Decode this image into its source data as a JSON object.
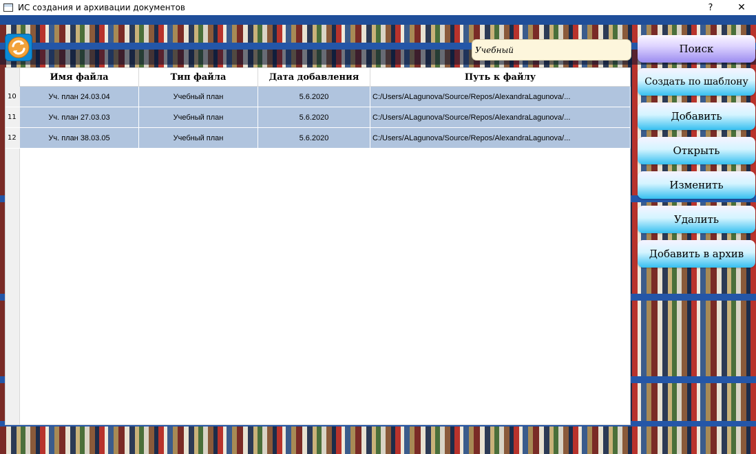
{
  "window": {
    "title": "ИС создания и архивации документов",
    "help_label": "?",
    "close_label": "✕"
  },
  "search": {
    "value": "Учебный"
  },
  "table": {
    "columns": [
      "Имя файла",
      "Тип файла",
      "Дата добавления",
      "Путь к файлу"
    ],
    "rows": [
      {
        "num": "10",
        "name": "Уч. план 24.03.04",
        "type": "Учебный план",
        "date": "5.6.2020",
        "path": "C:/Users/ALagunova/Source/Repos/AlexandraLagunova/..."
      },
      {
        "num": "11",
        "name": "Уч. план 27.03.03",
        "type": "Учебный план",
        "date": "5.6.2020",
        "path": "C:/Users/ALagunova/Source/Repos/AlexandraLagunova/..."
      },
      {
        "num": "12",
        "name": "Уч. план 38.03.05",
        "type": "Учебный план",
        "date": "5.6.2020",
        "path": "C:/Users/ALagunova/Source/Repos/AlexandraLagunova/..."
      }
    ]
  },
  "buttons": {
    "search": "Поиск",
    "create_template": "Создать по шаблону",
    "add": "Добавить",
    "open": "Открыть",
    "edit": "Изменить",
    "delete": "Удалить",
    "archive": "Добавить в архив"
  },
  "colors": {
    "row_selected": "#b0c4de",
    "search_bg": "#fdf6dc",
    "shelf_blue": "#2456a8",
    "button_accent": "#36bff0",
    "search_button_accent": "#9b8cf0"
  },
  "icons": {
    "app": "window-app-icon",
    "refresh": "refresh-arrows-icon"
  }
}
